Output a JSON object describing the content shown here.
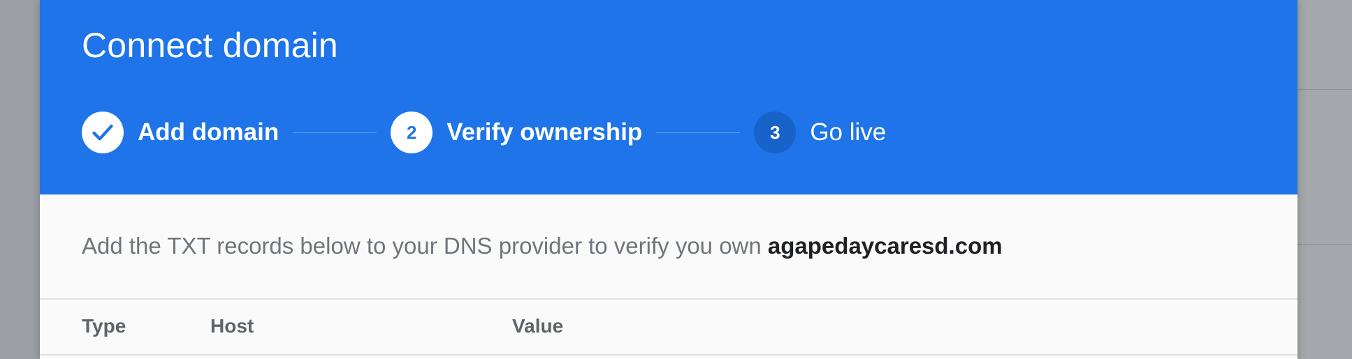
{
  "dialog": {
    "title": "Connect domain"
  },
  "stepper": {
    "steps": [
      {
        "label": "Add domain",
        "state": "completed",
        "icon": "check-icon"
      },
      {
        "label": "Verify ownership",
        "number": "2",
        "state": "active"
      },
      {
        "label": "Go live",
        "number": "3",
        "state": "pending"
      }
    ]
  },
  "instruction": {
    "text": "Add the TXT records below to your DNS provider to verify you own ",
    "domain": "agapedaycaresd.com"
  },
  "records_table": {
    "columns": [
      "Type",
      "Host",
      "Value"
    ]
  },
  "colors": {
    "header_bg": "#1e74e8",
    "pending_step_bg": "#1763c9",
    "body_bg": "#fafafa",
    "overlay": "#9c9fa4"
  }
}
